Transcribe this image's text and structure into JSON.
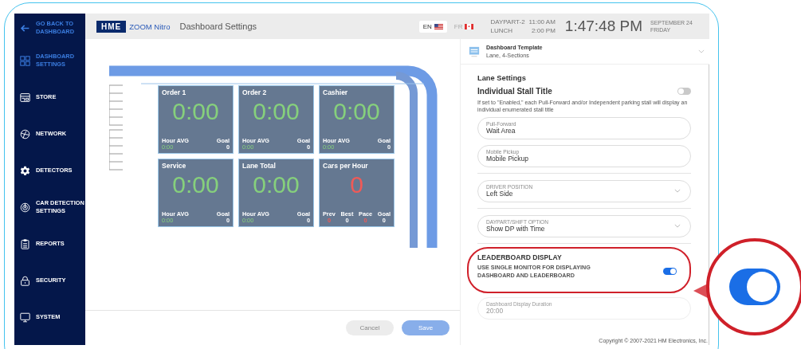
{
  "sidebar": {
    "back": {
      "label": "GO BACK TO DASHBOARD"
    },
    "items": [
      {
        "label": "DASHBOARD SETTINGS",
        "selected": true
      },
      {
        "label": "STORE",
        "selected": false
      },
      {
        "label": "NETWORK",
        "selected": false
      },
      {
        "label": "DETECTORS",
        "selected": false
      },
      {
        "label": "CAR DETECTION SETTINGS",
        "selected": false
      },
      {
        "label": "REPORTS",
        "selected": false
      },
      {
        "label": "SECURITY",
        "selected": false
      },
      {
        "label": "SYSTEM",
        "selected": false
      }
    ]
  },
  "header": {
    "logo": "HME",
    "product": "ZOOM Nitro",
    "title": "Dashboard Settings",
    "languages": [
      {
        "code": "EN",
        "selected": true
      },
      {
        "code": "FR",
        "selected": false
      }
    ],
    "daypart": {
      "name": "DAYPART-2",
      "meal": "LUNCH",
      "start": "11:00 AM",
      "end": "2:00 PM"
    },
    "clock": "1:47:48 PM",
    "date": "SEPTEMBER 24",
    "weekday": "FRIDAY"
  },
  "tiles": [
    {
      "kind": "timer",
      "title": "Order 1",
      "value": "0:00",
      "stats": [
        {
          "label": "Hour AVG",
          "value": "0:00"
        },
        {
          "label": "Goal",
          "value": "0"
        }
      ]
    },
    {
      "kind": "timer",
      "title": "Order 2",
      "value": "0:00",
      "stats": [
        {
          "label": "Hour AVG",
          "value": "0:00"
        },
        {
          "label": "Goal",
          "value": "0"
        }
      ]
    },
    {
      "kind": "timer",
      "title": "Cashier",
      "value": "0:00",
      "stats": [
        {
          "label": "Hour AVG",
          "value": "0:00"
        },
        {
          "label": "Goal",
          "value": "0"
        }
      ]
    },
    {
      "kind": "timer",
      "title": "Service",
      "value": "0:00",
      "stats": [
        {
          "label": "Hour AVG",
          "value": "0:00"
        },
        {
          "label": "Goal",
          "value": "0"
        }
      ]
    },
    {
      "kind": "timer",
      "title": "Lane Total",
      "value": "0:00",
      "stats": [
        {
          "label": "Hour AVG",
          "value": "0:00"
        },
        {
          "label": "Goal",
          "value": "0"
        }
      ]
    },
    {
      "kind": "count",
      "title": "Cars per Hour",
      "value": "0",
      "stats": [
        {
          "label": "Prev",
          "value": "0"
        },
        {
          "label": "Best",
          "value": "0"
        },
        {
          "label": "Pace",
          "value": "0"
        },
        {
          "label": "Goal",
          "value": "0"
        }
      ]
    }
  ],
  "buttons": [
    {
      "label": "Cancel",
      "kind": "secondary"
    },
    {
      "label": "Save",
      "kind": "primary"
    }
  ],
  "template": {
    "title": "Dashboard Template",
    "value": "Lane, 4-Sections"
  },
  "lane_settings": {
    "heading": "Lane Settings",
    "stall_title": {
      "label": "Individual Stall Title",
      "on": false
    },
    "description": "If set to \"Enabled,\" each Pull-Forward and/or Independent parking stall will display an individual enumerated stall title",
    "fields": [
      {
        "kind": "text",
        "label": "Pull-Forward",
        "value": "Wait Area",
        "disabled": false
      },
      {
        "kind": "text",
        "label": "Mobile Pickup",
        "value": "Mobile Pickup",
        "disabled": false
      },
      {
        "kind": "select",
        "label": "DRIVER POSITION",
        "value": "Left Side",
        "disabled": false
      },
      {
        "kind": "select",
        "label": "DAYPART/SHIFT OPTION",
        "value": "Show DP with Time",
        "disabled": false
      }
    ],
    "leaderboard": {
      "heading": "LEADERBOARD DISPLAY",
      "label": "USE SINGLE MONITOR FOR DISPLAYING DASHBOARD AND LEADERBOARD",
      "on": true
    },
    "duration": {
      "label": "Dashboard Display Duration",
      "value": "20:00",
      "disabled": true
    }
  },
  "copyright": "Copyright © 2007-2021 HM Electronics, Inc."
}
